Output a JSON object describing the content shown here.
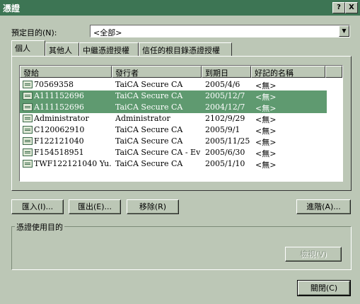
{
  "window": {
    "title": "憑證",
    "help": "?",
    "close": "X"
  },
  "purpose": {
    "label": "預定目的(N):",
    "value": "<全部>"
  },
  "tabs": [
    {
      "label": "個人"
    },
    {
      "label": "其他人"
    },
    {
      "label": "中繼憑證授權"
    },
    {
      "label": "信任的根目錄憑證授權"
    }
  ],
  "columns": [
    "發給",
    "發行者",
    "到期日",
    "好記的名稱"
  ],
  "rows": [
    {
      "issued_to": "70569358",
      "issuer": "TaiCA Secure CA",
      "expires": "2005/4/6",
      "friendly": "<無>",
      "selected": false
    },
    {
      "issued_to": "A111152696",
      "issuer": "TaiCA Secure CA",
      "expires": "2005/12/7",
      "friendly": "<無>",
      "selected": true
    },
    {
      "issued_to": "A111152696",
      "issuer": "TaiCA Secure CA",
      "expires": "2004/12/7",
      "friendly": "<無>",
      "selected": true
    },
    {
      "issued_to": "Administrator",
      "issuer": "Administrator",
      "expires": "2102/9/29",
      "friendly": "<無>",
      "selected": false
    },
    {
      "issued_to": "C120062910",
      "issuer": "TaiCA Secure CA",
      "expires": "2005/9/1",
      "friendly": "<無>",
      "selected": false
    },
    {
      "issued_to": "F122121040",
      "issuer": "TaiCA Secure CA",
      "expires": "2005/11/25",
      "friendly": "<無>",
      "selected": false
    },
    {
      "issued_to": "F154518951",
      "issuer": "TaiCA Secure CA - Ev...",
      "expires": "2005/6/30",
      "friendly": "<無>",
      "selected": false
    },
    {
      "issued_to": "TWF122121040 Yu...",
      "issuer": "TaiCA Secure CA",
      "expires": "2005/1/10",
      "friendly": "<無>",
      "selected": false
    }
  ],
  "buttons": {
    "import": "匯入(I)...",
    "export": "匯出(E)...",
    "remove": "移除(R)",
    "advanced": "進階(A)...",
    "view": "檢視(V)",
    "close": "關閉(C)"
  },
  "usage_group": {
    "label": "憑證使用目的"
  },
  "colors": {
    "titlebar": "#3d7554",
    "face": "#bcc7b6",
    "selection": "#5f9a70"
  }
}
